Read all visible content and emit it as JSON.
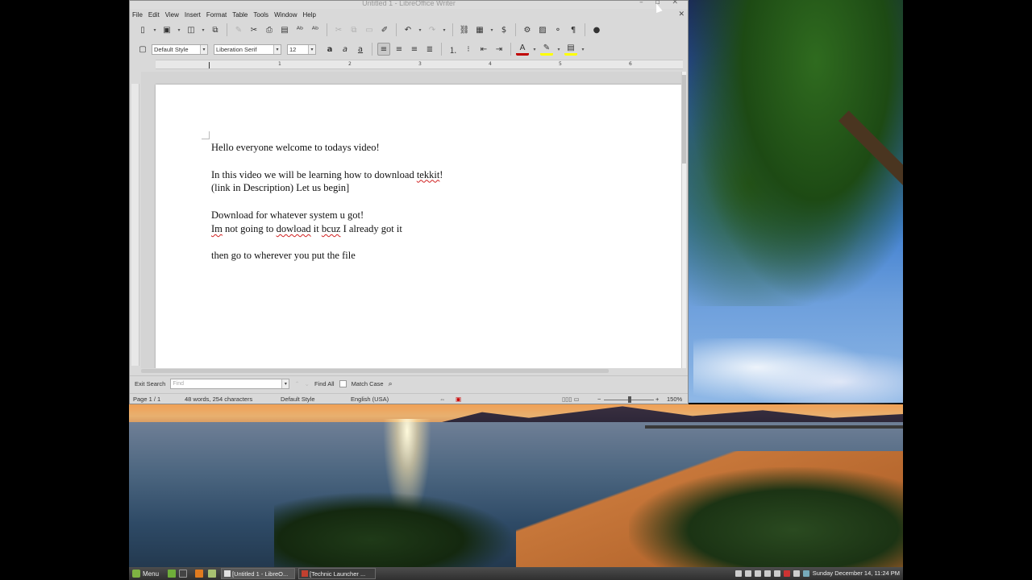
{
  "window": {
    "title": "Untitled 1 - LibreOffice Writer",
    "controls": "– ▫ ✕",
    "doc_close": "✕"
  },
  "menubar": [
    "File",
    "Edit",
    "View",
    "Insert",
    "Format",
    "Table",
    "Tools",
    "Window",
    "Help"
  ],
  "formatting": {
    "paragraph_style": "Default Style",
    "font_name": "Liberation Serif",
    "font_size": "12",
    "bold": "a",
    "italic": "a",
    "underline": "a"
  },
  "ruler_numbers": [
    "1",
    "2",
    "3",
    "4",
    "5",
    "6"
  ],
  "document": {
    "lines": [
      "Hello everyone welcome to todays video!",
      "",
      "In this video we will be learning how to download tekkit!",
      "(link in Description) Let us begin]",
      "",
      "Download for whatever system u got!",
      "Im not going to dowload it bcuz I already got it",
      "",
      "then go to wherever you put the file"
    ]
  },
  "findbar": {
    "exit": "Exit Search",
    "placeholder": "Find",
    "find_all": "Find All",
    "match_case": "Match Case"
  },
  "statusbar": {
    "page": "Page 1 / 1",
    "words": "48 words, 254 characters",
    "style": "Default Style",
    "language": "English (USA)",
    "zoom": "150%"
  },
  "taskbar": {
    "menu": "Menu",
    "tasks": [
      "[Untitled 1 - LibreO...",
      "[Technic Launcher ..."
    ],
    "clock": "Sunday December 14, 11:24 PM"
  }
}
